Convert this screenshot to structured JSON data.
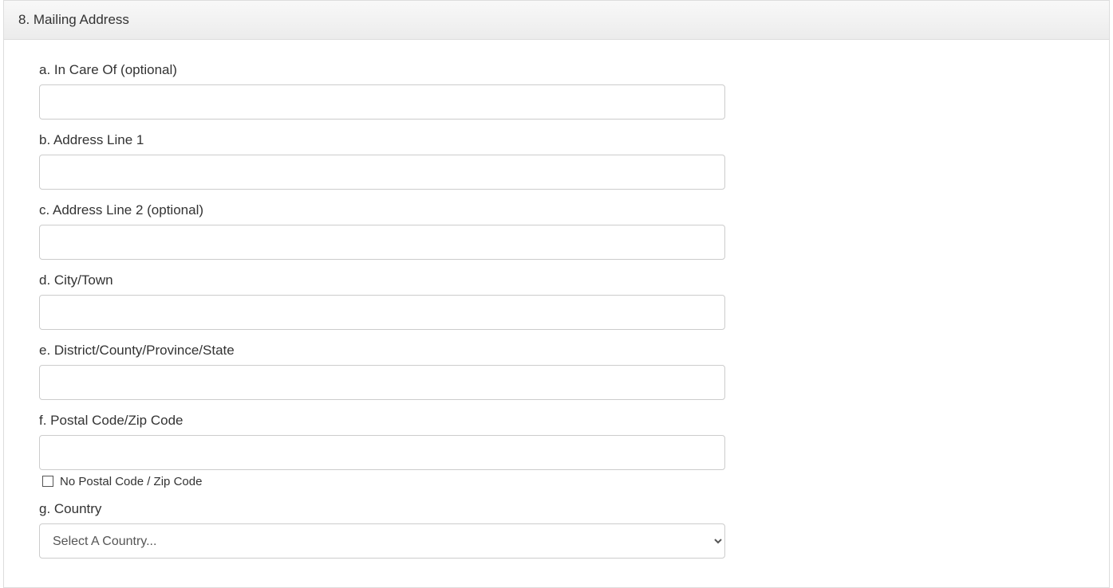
{
  "section": {
    "title": "8. Mailing Address"
  },
  "fields": {
    "a": {
      "label": "a. In Care Of (optional)",
      "value": ""
    },
    "b": {
      "label": "b. Address Line 1",
      "value": ""
    },
    "c": {
      "label": "c. Address Line 2 (optional)",
      "value": ""
    },
    "d": {
      "label": "d. City/Town",
      "value": ""
    },
    "e": {
      "label": "e. District/County/Province/State",
      "value": ""
    },
    "f": {
      "label": "f. Postal Code/Zip Code",
      "value": ""
    },
    "noPostal": {
      "label": "No Postal Code / Zip Code",
      "checked": false
    },
    "g": {
      "label": "g. Country",
      "selected": "Select A Country...",
      "options": [
        "Select A Country..."
      ]
    }
  }
}
